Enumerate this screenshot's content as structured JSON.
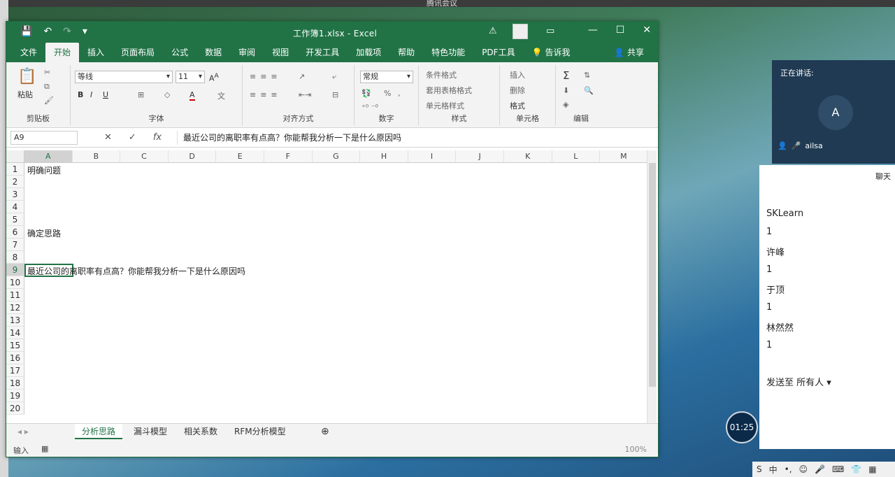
{
  "desktop": {
    "meeting_label": "腾讯会议"
  },
  "window": {
    "title": "工作簿1.xlsx  -  Excel",
    "qat": [
      "💾",
      "↶",
      "↷",
      "▾"
    ]
  },
  "tabs": [
    "文件",
    "开始",
    "插入",
    "页面布局",
    "公式",
    "数据",
    "审阅",
    "视图",
    "开发工具",
    "加载项",
    "帮助",
    "特色功能",
    "PDF工具"
  ],
  "tell_me": "告诉我",
  "share": "共享",
  "ribbon": {
    "clipboard": {
      "paste": "粘贴",
      "label": "剪贴板"
    },
    "font": {
      "name": "等线",
      "size": "11",
      "label": "字体"
    },
    "alignment": {
      "label": "对齐方式"
    },
    "number": {
      "format": "常规",
      "label": "数字"
    },
    "styles": {
      "cond": "条件格式",
      "table": "套用表格格式",
      "cell": "单元格样式",
      "label": "样式"
    },
    "cells": {
      "insert": "插入",
      "delete": "删除",
      "format": "格式",
      "label": "单元格"
    },
    "editing": {
      "label": "编辑"
    }
  },
  "formula_bar": {
    "name_box": "A9",
    "content": "最近公司的离职率有点高？你能帮我分析一下是什么原因吗"
  },
  "columns": [
    "A",
    "B",
    "C",
    "D",
    "E",
    "F",
    "G",
    "H",
    "I",
    "J",
    "K",
    "L",
    "M"
  ],
  "rows": [
    "1",
    "2",
    "3",
    "4",
    "5",
    "6",
    "7",
    "8",
    "9",
    "10",
    "11",
    "12",
    "13",
    "14",
    "15",
    "16",
    "17",
    "18",
    "19",
    "20"
  ],
  "cells": {
    "a1": "明确问题",
    "a6": "确定思路",
    "a9": "最近公司的离职率有点高？你能帮我分析一下是什么原因吗"
  },
  "sheets": [
    "分析思路",
    "漏斗模型",
    "相关系数",
    "RFM分析模型"
  ],
  "status": {
    "mode": "输入",
    "zoom": "100%"
  },
  "meeting": {
    "speaking_label": "正在讲话:",
    "speaker_initial": "A",
    "speaker_name": "ailsa",
    "chat_title": "聊天",
    "messages": [
      "SKLearn",
      "1",
      "许峰",
      "1",
      "于顶",
      "1",
      "林然然",
      "1"
    ],
    "send_to": "发送至 所有人 ▾",
    "timer": "01:25"
  },
  "ime": {
    "lang": "中"
  }
}
